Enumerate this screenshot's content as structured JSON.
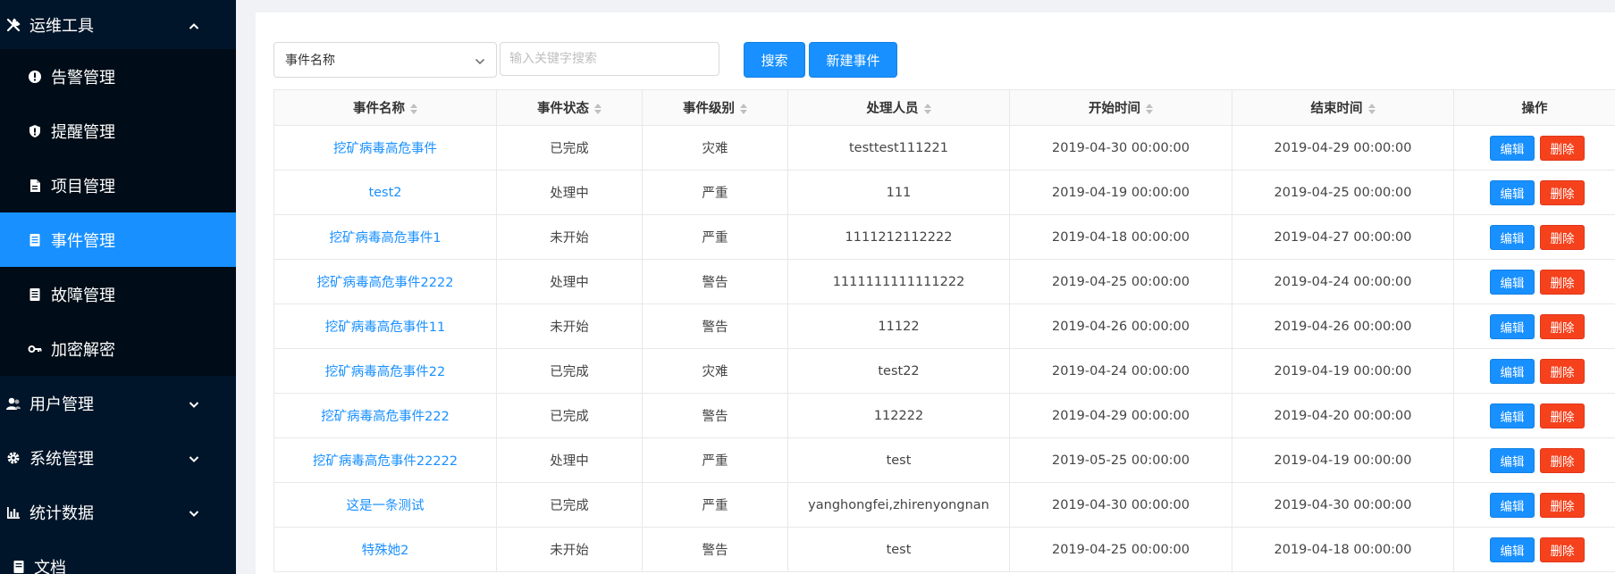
{
  "sidebar": {
    "groups": [
      {
        "label": "运维工具",
        "icon": "tools-icon",
        "expanded": true,
        "items": [
          {
            "label": "告警管理",
            "icon": "alert-circle-icon"
          },
          {
            "label": "提醒管理",
            "icon": "shield-icon"
          },
          {
            "label": "项目管理",
            "icon": "file-icon"
          },
          {
            "label": "事件管理",
            "icon": "book-icon",
            "active": true
          },
          {
            "label": "故障管理",
            "icon": "book-icon"
          },
          {
            "label": "加密解密",
            "icon": "key-icon"
          }
        ]
      },
      {
        "label": "用户管理",
        "icon": "users-icon",
        "expanded": false
      },
      {
        "label": "系统管理",
        "icon": "gear-icon",
        "expanded": false
      },
      {
        "label": "统计数据",
        "icon": "bar-chart-icon",
        "expanded": false
      },
      {
        "label": "文档",
        "icon": "book-icon",
        "expanded": false
      }
    ]
  },
  "toolbar": {
    "select_value": "事件名称",
    "search_placeholder": "输入关键字搜索",
    "search_label": "搜索",
    "new_label": "新建事件"
  },
  "table": {
    "columns": [
      "事件名称",
      "事件状态",
      "事件级别",
      "处理人员",
      "开始时间",
      "结束时间",
      "操作"
    ],
    "edit_label": "编辑",
    "delete_label": "删除",
    "rows": [
      {
        "name": "挖矿病毒高危事件",
        "status": "已完成",
        "level": "灾难",
        "handler": "testtest111221",
        "start": "2019-04-30 00:00:00",
        "end": "2019-04-29 00:00:00"
      },
      {
        "name": "test2",
        "status": "处理中",
        "level": "严重",
        "handler": "111",
        "start": "2019-04-19 00:00:00",
        "end": "2019-04-25 00:00:00"
      },
      {
        "name": "挖矿病毒高危事件1",
        "status": "未开始",
        "level": "严重",
        "handler": "1111212112222",
        "start": "2019-04-18 00:00:00",
        "end": "2019-04-27 00:00:00"
      },
      {
        "name": "挖矿病毒高危事件2222",
        "status": "处理中",
        "level": "警告",
        "handler": "1111111111111222",
        "start": "2019-04-25 00:00:00",
        "end": "2019-04-24 00:00:00"
      },
      {
        "name": "挖矿病毒高危事件11",
        "status": "未开始",
        "level": "警告",
        "handler": "11122",
        "start": "2019-04-26 00:00:00",
        "end": "2019-04-26 00:00:00"
      },
      {
        "name": "挖矿病毒高危事件22",
        "status": "已完成",
        "level": "灾难",
        "handler": "test22",
        "start": "2019-04-24 00:00:00",
        "end": "2019-04-19 00:00:00"
      },
      {
        "name": "挖矿病毒高危事件222",
        "status": "已完成",
        "level": "警告",
        "handler": "112222",
        "start": "2019-04-29 00:00:00",
        "end": "2019-04-20 00:00:00"
      },
      {
        "name": "挖矿病毒高危事件22222",
        "status": "处理中",
        "level": "严重",
        "handler": "test",
        "start": "2019-05-25 00:00:00",
        "end": "2019-04-19 00:00:00"
      },
      {
        "name": "这是一条测试",
        "status": "已完成",
        "level": "严重",
        "handler": "yanghongfei,zhirenyongnan",
        "start": "2019-04-30 00:00:00",
        "end": "2019-04-30 00:00:00"
      },
      {
        "name": "特殊她2",
        "status": "未开始",
        "level": "警告",
        "handler": "test",
        "start": "2019-04-25 00:00:00",
        "end": "2019-04-18 00:00:00"
      }
    ]
  },
  "colors": {
    "sidebar_bg": "#001529",
    "submenu_bg": "#000c17",
    "primary": "#1890ff",
    "danger": "#f5421d"
  }
}
